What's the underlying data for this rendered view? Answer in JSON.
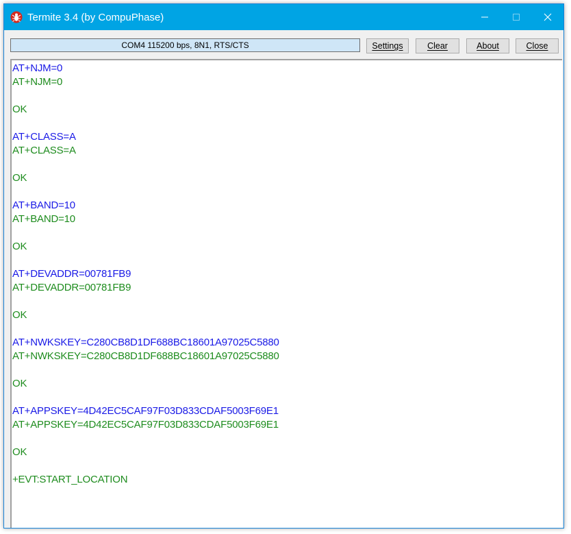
{
  "window": {
    "title": "Termite 3.4 (by CompuPhase)",
    "controls": {
      "minimize_icon": "minimize-icon",
      "maximize_icon": "maximize-icon",
      "close_icon": "close-icon"
    }
  },
  "toolbar": {
    "connection_status": "COM4 115200 bps, 8N1, RTS/CTS",
    "settings_label": "Settings",
    "clear_label": "Clear",
    "about_label": "About",
    "close_label": "Close"
  },
  "colors": {
    "titlebar": "#00a4e4",
    "sent_text": "#1a1ae6",
    "received_text": "#1e8c1e",
    "status_field": "#cfe6f7"
  },
  "terminal": {
    "lines": [
      {
        "text": "AT+NJM=0",
        "kind": "sent"
      },
      {
        "text": "AT+NJM=0",
        "kind": "recv"
      },
      {
        "text": "",
        "kind": "recv"
      },
      {
        "text": "OK",
        "kind": "recv"
      },
      {
        "text": "",
        "kind": "recv"
      },
      {
        "text": "AT+CLASS=A",
        "kind": "sent"
      },
      {
        "text": "AT+CLASS=A",
        "kind": "recv"
      },
      {
        "text": "",
        "kind": "recv"
      },
      {
        "text": "OK",
        "kind": "recv"
      },
      {
        "text": "",
        "kind": "recv"
      },
      {
        "text": "AT+BAND=10",
        "kind": "sent"
      },
      {
        "text": "AT+BAND=10",
        "kind": "recv"
      },
      {
        "text": "",
        "kind": "recv"
      },
      {
        "text": "OK",
        "kind": "recv"
      },
      {
        "text": "",
        "kind": "recv"
      },
      {
        "text": "AT+DEVADDR=00781FB9",
        "kind": "sent"
      },
      {
        "text": "AT+DEVADDR=00781FB9",
        "kind": "recv"
      },
      {
        "text": "",
        "kind": "recv"
      },
      {
        "text": "OK",
        "kind": "recv"
      },
      {
        "text": "",
        "kind": "recv"
      },
      {
        "text": "AT+NWKSKEY=C280CB8D1DF688BC18601A97025C5880",
        "kind": "sent"
      },
      {
        "text": "AT+NWKSKEY=C280CB8D1DF688BC18601A97025C5880",
        "kind": "recv"
      },
      {
        "text": "",
        "kind": "recv"
      },
      {
        "text": "OK",
        "kind": "recv"
      },
      {
        "text": "",
        "kind": "recv"
      },
      {
        "text": "AT+APPSKEY=4D42EC5CAF97F03D833CDAF5003F69E1",
        "kind": "sent"
      },
      {
        "text": "AT+APPSKEY=4D42EC5CAF97F03D833CDAF5003F69E1",
        "kind": "recv"
      },
      {
        "text": "",
        "kind": "recv"
      },
      {
        "text": "OK",
        "kind": "recv"
      },
      {
        "text": "",
        "kind": "recv"
      },
      {
        "text": "+EVT:START_LOCATION",
        "kind": "recv"
      }
    ]
  }
}
